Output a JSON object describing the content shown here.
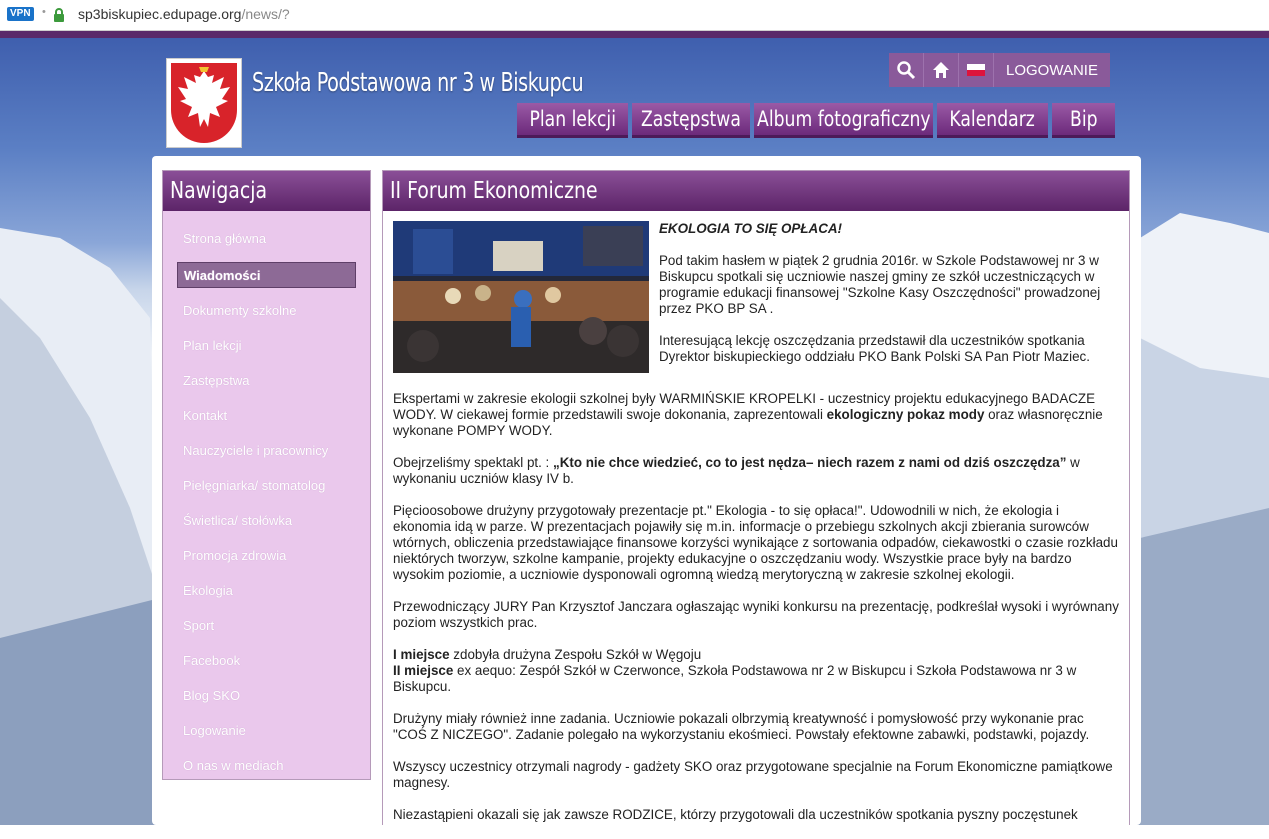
{
  "browser": {
    "vpn_label": "VPN",
    "url_host": "sp3biskupiec.edupage.org",
    "url_path": "/news/?"
  },
  "header": {
    "site_title": "Szkoła Podstawowa nr 3 w Biskupcu",
    "login_label": "LOGOWANIE"
  },
  "main_nav": [
    {
      "label": "Plan lekcji"
    },
    {
      "label": "Zastępstwa"
    },
    {
      "label": "Album fotograficzny"
    },
    {
      "label": "Kalendarz"
    },
    {
      "label": "Bip"
    }
  ],
  "sidebar": {
    "title": "Nawigacja",
    "items": [
      {
        "label": "Strona główna"
      },
      {
        "label": "Wiadomości",
        "active": true
      },
      {
        "label": "Dokumenty szkolne"
      },
      {
        "label": "Plan lekcji"
      },
      {
        "label": "Zastępstwa"
      },
      {
        "label": "Kontakt"
      },
      {
        "label": "Nauczyciele i pracownicy"
      },
      {
        "label": "Pielęgniarka/ stomatolog"
      },
      {
        "label": "Świetlica/ stołówka"
      },
      {
        "label": "Promocja zdrowia"
      },
      {
        "label": "Ekologia"
      },
      {
        "label": "Sport"
      },
      {
        "label": "Facebook"
      },
      {
        "label": "Blog SKO"
      },
      {
        "label": "Logowanie"
      },
      {
        "label": "O nas w mediach"
      }
    ]
  },
  "article": {
    "title": "II Forum Ekonomiczne",
    "lead": "EKOLOGIA TO SIĘ OPŁACA!",
    "p1": "Pod takim hasłem w piątek  2 grudnia 2016r. w Szkole Podstawowej nr 3 w Biskupcu spotkali się uczniowie naszej gminy  ze szkół uczestniczących w programie edukacji finansowej \"Szkolne Kasy Oszczędności\" prowadzonej przez PKO BP SA .",
    "p2": "Interesującą lekcję oszczędzania przedstawił dla uczestników spotkania Dyrektor biskupieckiego oddziału PKO Bank Polski SA Pan Piotr Maziec.",
    "p3_a": "Ekspertami w zakresie ekologii szkolnej były WARMIŃSKIE KROPELKI - uczestnicy projektu edukacyjnego BADACZE WODY. W ciekawej formie przedstawili swoje dokonania, zaprezentowali ",
    "p3_b": "ekologiczny pokaz mody",
    "p3_c": " oraz własnoręcznie wykonane POMPY WODY.",
    "p4_a": "Obejrzeliśmy spektakl pt. : ",
    "p4_b": "„Kto nie chce wiedzieć, co to jest nędza– niech razem z nami od dziś oszczędza”",
    "p4_c": " w wykonaniu uczniów klasy IV b.",
    "p5": "Pięcioosobowe drużyny przygotowały prezentacje pt.\" Ekologia - to się opłaca!\". Udowodnili w nich, że ekologia i ekonomia idą w parze. W prezentacjach pojawiły się m.in. informacje o przebiegu szkolnych akcji zbierania surowców wtórnych, obliczenia przedstawiające finansowe korzyści wynikające z sortowania odpadów, ciekawostki o czasie rozkładu niektórych tworzyw, szkolne kampanie, projekty edukacyjne o oszczędzaniu wody. Wszystkie prace były na bardzo  wysokim poziomie, a uczniowie dysponowali ogromną wiedzą merytoryczną w zakresie szkolnej ekologii.",
    "p6": "Przewodniczący JURY Pan Krzysztof Janczara ogłaszając wyniki konkursu na prezentację, podkreślał wysoki i wyrównany  poziom wszystkich prac.",
    "p7_a_bold": "I miejsce",
    "p7_a": " zdobyła drużyna Zespołu Szkół w Węgoju",
    "p7_b_bold": "II miejsce",
    "p7_b": " ex aequo: Zespół Szkół w Czerwonce, Szkoła Podstawowa nr 2 w Biskupcu i Szkoła Podstawowa nr 3 w Biskupcu.",
    "p8": "Drużyny miały również inne zadania. Uczniowie pokazali olbrzymią kreatywność i pomysłowość przy wykonanie prac \"COŚ Z NICZEGO\". Zadanie polegało na wykorzystaniu ekośmieci. Powstały efektowne zabawki, podstawki, pojazdy.",
    "p9": "Wszyscy uczestnicy otrzymali nagrody - gadżety SKO oraz przygotowane specjalnie na Forum Ekonomiczne pamiątkowe magnesy.",
    "p10": "Niezastąpieni okazali się jak zawsze RODZICE, którzy przygotowali dla uczestników spotkania pyszny poczęstunek"
  }
}
